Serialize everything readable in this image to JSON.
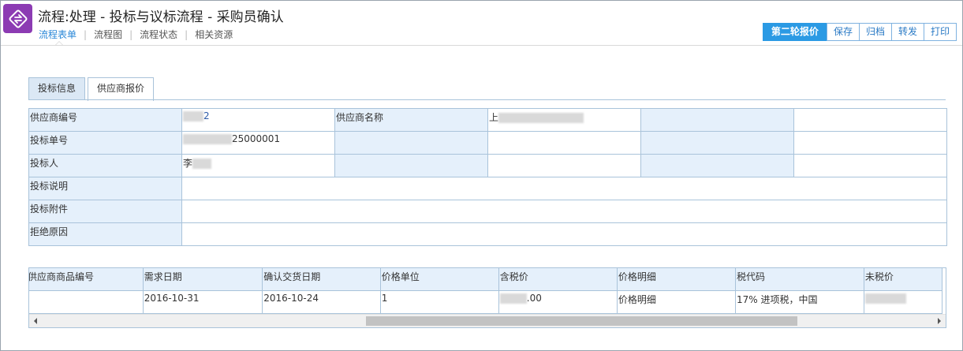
{
  "header": {
    "title": "流程:处理 - 投标与议标流程 - 采购员确认",
    "icon": "flow-sync-icon",
    "brand_color": "#8c3bb3"
  },
  "nav": {
    "items": [
      "流程表单",
      "流程图",
      "流程状态",
      "相关资源"
    ],
    "active": "流程表单"
  },
  "toolbar": {
    "primary_label": "第二轮报价",
    "save_label": "保存",
    "archive_label": "归档",
    "forward_label": "转发",
    "print_label": "打印",
    "accent_color": "#2b9ae4"
  },
  "tabs": {
    "bid_info": "投标信息",
    "supplier_quote": "供应商报价",
    "active": "供应商报价"
  },
  "form": {
    "supplier_code_label": "供应商编号",
    "supplier_code_value": "2",
    "supplier_name_label": "供应商名称",
    "supplier_name_value": "上",
    "bid_no_label": "投标单号",
    "bid_no_value": "25000001",
    "bidder_label": "投标人",
    "bidder_value": "李",
    "bid_desc_label": "投标说明",
    "bid_attach_label": "投标附件",
    "reject_reason_label": "拒绝原因"
  },
  "items_table": {
    "columns": [
      "供应商商品编号",
      "需求日期",
      "确认交货日期",
      "价格单位",
      "含税价",
      "价格明细",
      "税代码",
      "未税价"
    ],
    "rows": [
      {
        "supplier_item_no": "",
        "required_date": "2016-10-31",
        "confirmed_delivery_date": "2016-10-24",
        "price_unit": "1",
        "tax_included_price": ".00",
        "price_detail": "价格明细",
        "tax_code": "17% 进项税，中国",
        "untaxed_price": ""
      }
    ]
  }
}
